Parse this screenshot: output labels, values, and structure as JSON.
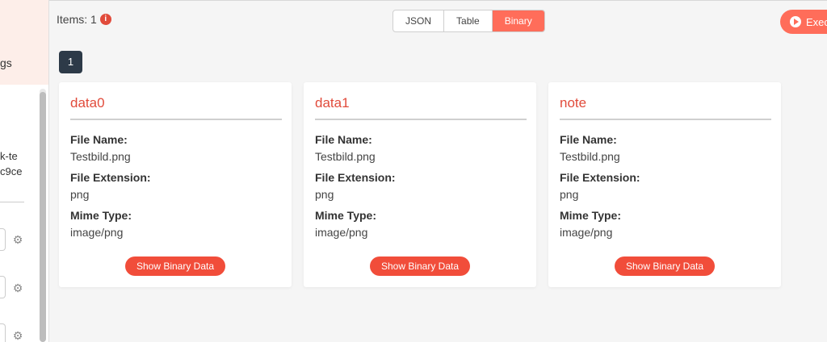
{
  "header": {
    "items_label": "Items: 1",
    "info_icon_glyph": "i",
    "view_tabs": [
      {
        "label": "JSON",
        "active": false
      },
      {
        "label": "Table",
        "active": false
      },
      {
        "label": "Binary",
        "active": true
      }
    ],
    "execute_label": "Exec"
  },
  "pagination": {
    "current_page": "1"
  },
  "left_panel": {
    "tab_fragment": "gs",
    "node_line_1": "k-te",
    "node_line_2": "c9ce",
    "gear_icon_glyph": "⚙"
  },
  "binary_items": [
    {
      "title": "data0",
      "file_name_label": "File Name:",
      "file_name": "Testbild.png",
      "file_extension_label": "File Extension:",
      "file_extension": "png",
      "mime_type_label": "Mime Type:",
      "mime_type": "image/png",
      "button_label": "Show Binary Data"
    },
    {
      "title": "data1",
      "file_name_label": "File Name:",
      "file_name": "Testbild.png",
      "file_extension_label": "File Extension:",
      "file_extension": "png",
      "mime_type_label": "Mime Type:",
      "mime_type": "image/png",
      "button_label": "Show Binary Data"
    },
    {
      "title": "note",
      "file_name_label": "File Name:",
      "file_name": "Testbild.png",
      "file_extension_label": "File Extension:",
      "file_extension": "png",
      "mime_type_label": "Mime Type:",
      "mime_type": "image/png",
      "button_label": "Show Binary Data"
    }
  ],
  "colors": {
    "accent": "#ff6d5a",
    "title_red": "#e14b3b",
    "badge_dark": "#2d3a48"
  }
}
